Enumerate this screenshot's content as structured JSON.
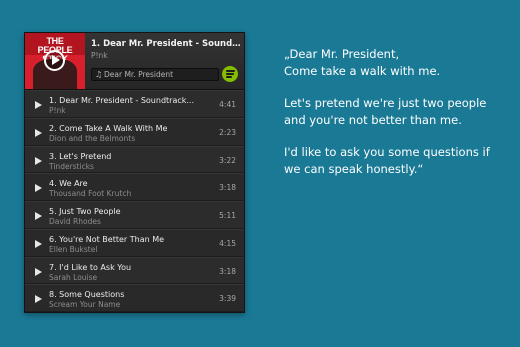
{
  "player": {
    "album_art_text": "THE PEOPLE STICK",
    "now_playing": {
      "title": "1. Dear Mr. President - Soundtrack...",
      "artist": "P!nk"
    },
    "search": {
      "placeholder": "Dear Mr. President"
    },
    "icons": {
      "search": "music-note-icon",
      "brand": "spotify-icon",
      "play": "play-icon"
    },
    "colors": {
      "background": "#1a7a96",
      "spotify_green": "#84bd00"
    },
    "tracks": [
      {
        "title": "1. Dear Mr. President - Soundtrack...",
        "artist": "P!nk",
        "duration": "4:41"
      },
      {
        "title": "2. Come Take A Walk With Me",
        "artist": "Dion and the Belmonts",
        "duration": "2:23"
      },
      {
        "title": "3. Let's Pretend",
        "artist": "Tindersticks",
        "duration": "3:22"
      },
      {
        "title": "4. We Are",
        "artist": "Thousand Foot Krutch",
        "duration": "3:18"
      },
      {
        "title": "5. Just Two People",
        "artist": "David Rhodes",
        "duration": "5:11"
      },
      {
        "title": "6. You're Not Better Than Me",
        "artist": "Ellen Bukstel",
        "duration": "4:15"
      },
      {
        "title": "7. I'd Like to Ask You",
        "artist": "Sarah Louise",
        "duration": "3:18"
      },
      {
        "title": "8. Some Questions",
        "artist": "Scream Your Name",
        "duration": "3:39"
      }
    ]
  },
  "quote": {
    "lines": [
      "„Dear Mr. President,",
      "Come take a walk with me.",
      "Let's pretend we're just two people",
      "and you're not better than me.",
      "I'd like to ask you some questions if",
      "we can speak honestly.“"
    ]
  }
}
